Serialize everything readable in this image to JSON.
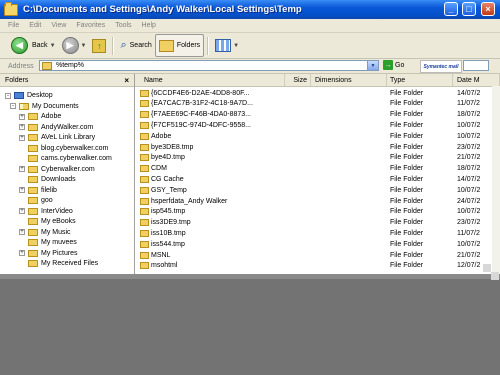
{
  "window": {
    "title": "C:\\Documents and Settings\\Andy Walker\\Local Settings\\Temp"
  },
  "menu": [
    "File",
    "Edit",
    "View",
    "Favorites",
    "Tools",
    "Help"
  ],
  "toolbar": {
    "back_label": "Back",
    "search_label": "Search",
    "folders_label": "Folders"
  },
  "address": {
    "label": "Address",
    "value": "%temp%",
    "go_label": "Go"
  },
  "logo": {
    "text": "Symantec mail"
  },
  "folders_pane": {
    "title": "Folders",
    "tree": [
      {
        "label": "Desktop",
        "level": 0,
        "expander": "-"
      },
      {
        "label": "My Documents",
        "level": 1,
        "expander": "-"
      },
      {
        "label": "Adobe",
        "level": 2,
        "expander": "+"
      },
      {
        "label": "AndyWalker.com",
        "level": 2,
        "expander": "+"
      },
      {
        "label": "AVeL Link Library",
        "level": 2,
        "expander": "+"
      },
      {
        "label": "blog.cyberwalker.com",
        "level": 2,
        "expander": ""
      },
      {
        "label": "cams.cyberwalker.com",
        "level": 2,
        "expander": ""
      },
      {
        "label": "Cyberwalker.com",
        "level": 2,
        "expander": "+"
      },
      {
        "label": "Downloads",
        "level": 2,
        "expander": ""
      },
      {
        "label": "filelib",
        "level": 2,
        "expander": "+"
      },
      {
        "label": "goo",
        "level": 2,
        "expander": ""
      },
      {
        "label": "InterVideo",
        "level": 2,
        "expander": "+"
      },
      {
        "label": "My eBooks",
        "level": 2,
        "expander": ""
      },
      {
        "label": "My Music",
        "level": 2,
        "expander": "+"
      },
      {
        "label": "My muvees",
        "level": 2,
        "expander": ""
      },
      {
        "label": "My Pictures",
        "level": 2,
        "expander": "+"
      },
      {
        "label": "My Received Files",
        "level": 2,
        "expander": ""
      }
    ]
  },
  "list": {
    "columns": [
      "Name",
      "Size",
      "Dimensions",
      "Type",
      "Date M"
    ],
    "rows": [
      {
        "name": "{6CCDF4E6-D2AE-4DD8-80F...",
        "type": "File Folder",
        "date": "14/07/2"
      },
      {
        "name": "{EA7CAC7B-31F2-4C18-9A7D...",
        "type": "File Folder",
        "date": "11/07/2"
      },
      {
        "name": "{F7AEE69C-F46B-4DA0-8873...",
        "type": "File Folder",
        "date": "18/07/2"
      },
      {
        "name": "{F7CF519C-974D-4DFC-9558...",
        "type": "File Folder",
        "date": "10/07/2"
      },
      {
        "name": "Adobe",
        "type": "File Folder",
        "date": "10/07/2"
      },
      {
        "name": "bye3DE8.tmp",
        "type": "File Folder",
        "date": "23/07/2"
      },
      {
        "name": "bye4D.tmp",
        "type": "File Folder",
        "date": "21/07/2"
      },
      {
        "name": "CDM",
        "type": "File Folder",
        "date": "18/07/2"
      },
      {
        "name": "CG Cache",
        "type": "File Folder",
        "date": "14/07/2"
      },
      {
        "name": "GSY_Temp",
        "type": "File Folder",
        "date": "10/07/2"
      },
      {
        "name": "hsperfdata_Andy Walker",
        "type": "File Folder",
        "date": "24/07/2"
      },
      {
        "name": "isp545.tmp",
        "type": "File Folder",
        "date": "10/07/2"
      },
      {
        "name": "iss3DE9.tmp",
        "type": "File Folder",
        "date": "23/07/2"
      },
      {
        "name": "iss10B.tmp",
        "type": "File Folder",
        "date": "11/07/2"
      },
      {
        "name": "iss544.tmp",
        "type": "File Folder",
        "date": "10/07/2"
      },
      {
        "name": "MSNL",
        "type": "File Folder",
        "date": "21/07/2"
      },
      {
        "name": "msohtml",
        "type": "File Folder",
        "date": "12/07/2"
      }
    ]
  },
  "colors": {
    "titlebar": "#0a58d8",
    "window_bg": "#ece9d8",
    "folder": "#f0d060",
    "desktop_bg": "#737373"
  }
}
